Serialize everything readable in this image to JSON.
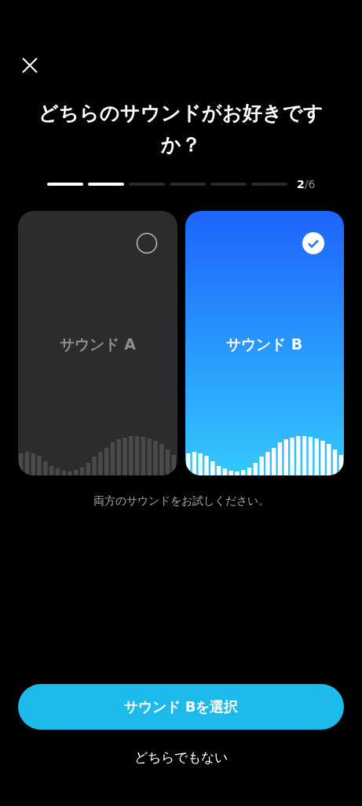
{
  "title": "どちらのサウンドがお好きですか？",
  "progress": {
    "steps": [
      {
        "done": true
      },
      {
        "done": true
      },
      {
        "done": false
      },
      {
        "done": false
      },
      {
        "done": false
      },
      {
        "done": false
      }
    ],
    "current": "2",
    "total": "/6"
  },
  "options": [
    {
      "label": "サウンド A",
      "selected": false
    },
    {
      "label": "サウンド B",
      "selected": true
    }
  ],
  "hint": "両方のサウンドをお試しください。",
  "primary_button": "サウンド Bを選択",
  "secondary_link": "どちらでもない"
}
